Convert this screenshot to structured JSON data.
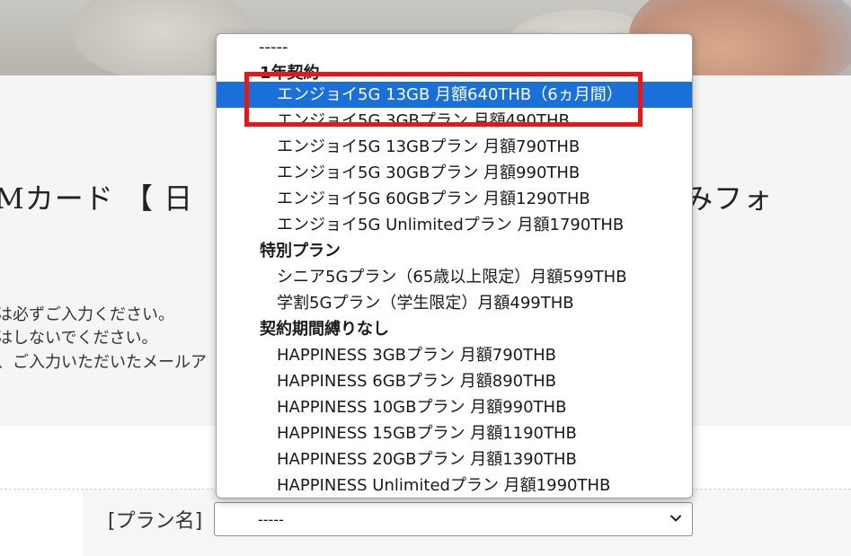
{
  "background": {
    "form_title": "Mカード 【 日",
    "form_title_right": "し込みフォ",
    "notes": [
      "は必ずご入力ください。",
      "はしないでください。",
      "、ご入力いただいたメールア"
    ]
  },
  "form": {
    "plan_label": "[プラン名]",
    "plan_select_value": "-----"
  },
  "dropdown": {
    "first_option": "-----",
    "groups": [
      {
        "label": "1年契約",
        "options": [
          "エンジョイ5G 13GB 月額640THB（6ヵ月間）",
          "エンジョイ5G 3GBプラン 月額490THB",
          "エンジョイ5G 13GBプラン 月額790THB",
          "エンジョイ5G 30GBプラン 月額990THB",
          "エンジョイ5G 60GBプラン 月額1290THB",
          "エンジョイ5G Unlimitedプラン 月額1790THB"
        ]
      },
      {
        "label": "特別プラン",
        "options": [
          "シニア5Gプラン（65歳以上限定）月額599THB",
          "学割5Gプラン（学生限定）月額499THB"
        ]
      },
      {
        "label": "契約期間縛りなし",
        "options": [
          "HAPPINESS 3GBプラン 月額790THB",
          "HAPPINESS 6GBプラン 月額890THB",
          "HAPPINESS 10GBプラン 月額990THB",
          "HAPPINESS 15GBプラン 月額1190THB",
          "HAPPINESS 20GBプラン 月額1390THB",
          "HAPPINESS Unlimitedプラン 月額1990THB"
        ]
      }
    ],
    "highlighted_option": "エンジョイ5G 13GB 月額640THB（6ヵ月間）"
  },
  "colors": {
    "selection": "#1a6fd8",
    "annotation": "#e31919"
  }
}
